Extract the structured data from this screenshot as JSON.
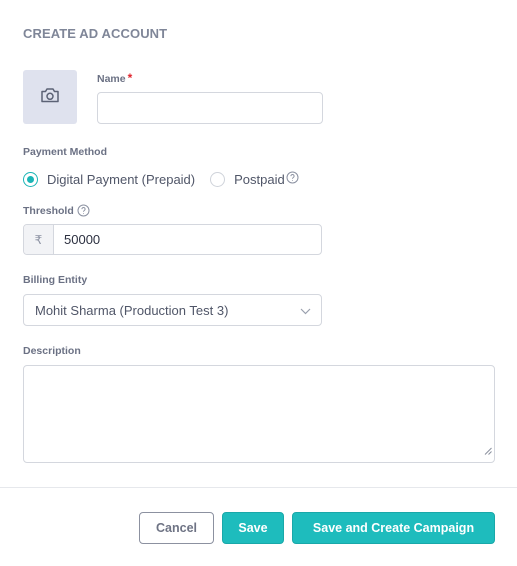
{
  "dialog": {
    "title": "CREATE AD ACCOUNT"
  },
  "icons": {
    "avatar": "camera-icon",
    "help": "question-circle-icon",
    "dropdown": "chevron-down-icon",
    "resize": "resize-handle-icon"
  },
  "name_field": {
    "label": "Name",
    "required_marker": "*",
    "value": ""
  },
  "payment_method": {
    "label": "Payment Method",
    "options": [
      {
        "label": "Digital Payment (Prepaid)",
        "selected": true
      },
      {
        "label": "Postpaid",
        "selected": false
      }
    ]
  },
  "threshold": {
    "label": "Threshold",
    "currency_symbol": "₹",
    "value": "50000"
  },
  "billing_entity": {
    "label": "Billing Entity",
    "selected": "Mohit Sharma (Production Test 3)"
  },
  "description": {
    "label": "Description",
    "value": ""
  },
  "footer": {
    "cancel_label": "Cancel",
    "save_label": "Save",
    "save_create_label": "Save and Create Campaign"
  },
  "colors": {
    "accent": "#1ebcbd",
    "required": "#e0242d",
    "avatar_bg": "#dfe2ee"
  }
}
